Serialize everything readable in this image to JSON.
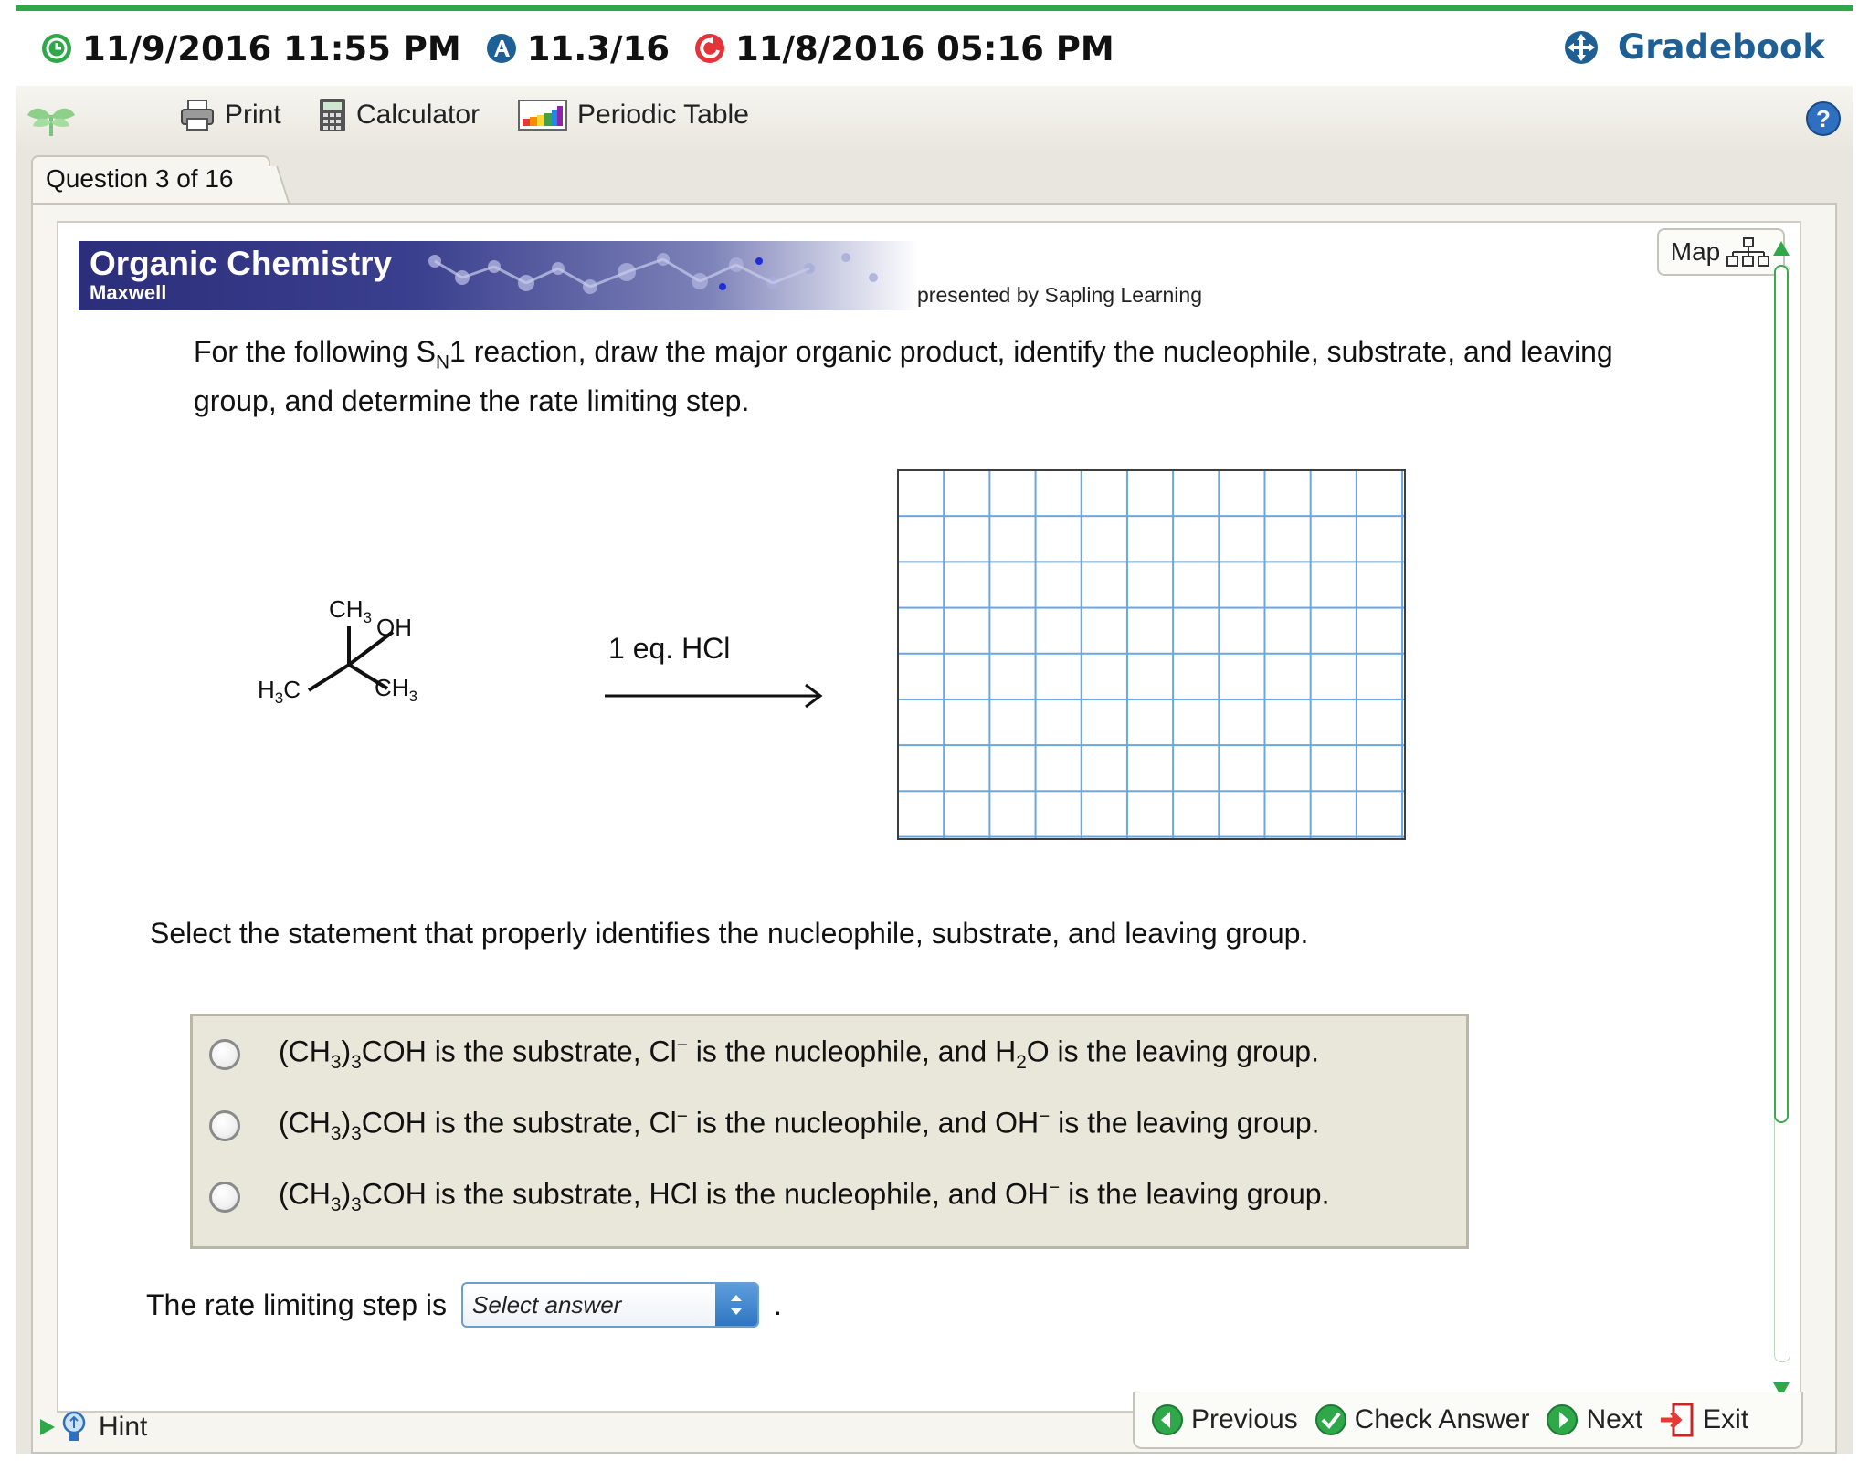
{
  "topbar": {
    "due_date": "11/9/2016 11:55 PM",
    "score": "11.3/16",
    "last_saved": "11/8/2016 05:16 PM",
    "gradebook_label": "Gradebook"
  },
  "toolbar": {
    "print_label": "Print",
    "calculator_label": "Calculator",
    "periodic_table_label": "Periodic Table"
  },
  "question_tab": "Question 3 of 16",
  "banner": {
    "title": "Organic Chemistry",
    "author": "Maxwell",
    "presented_by": "presented by Sapling Learning"
  },
  "map_label": "Map",
  "question": {
    "line_before_sub": "For the following S",
    "sub": "N",
    "line_after_sub": "1 reaction, draw the major organic product, identify the nucleophile, substrate, and leaving group, and determine the rate limiting step."
  },
  "reaction": {
    "reagent": "1 eq. HCl",
    "labels": {
      "top": "CH3",
      "oh": "OH",
      "left": "H3C",
      "right": "CH3"
    }
  },
  "statement": "Select the statement that properly identifies the nucleophile, substrate, and leaving group.",
  "options": [
    {
      "pre": "(CH",
      "s1": "3",
      "mid": ")",
      "s2": "3",
      "post": "COH is the substrate, Cl",
      "sup": "−",
      "tail1": " is the nucleophile, and H",
      "s3": "2",
      "tail2": "O is the leaving group."
    },
    {
      "pre": "(CH",
      "s1": "3",
      "mid": ")",
      "s2": "3",
      "post": "COH is the substrate, Cl",
      "sup": "−",
      "tail1": " is the nucleophile, and OH",
      "sup2": "−",
      "tail2": " is the leaving group."
    },
    {
      "pre": "(CH",
      "s1": "3",
      "mid": ")",
      "s2": "3",
      "post": "COH is the substrate, HCl is the nucleophile, and OH",
      "sup": "−",
      "tail2": " is the leaving group."
    }
  ],
  "rate_step": {
    "label": "The rate limiting step is",
    "select_placeholder": "Select answer",
    "suffix": "."
  },
  "bottom_nav": {
    "previous": "Previous",
    "check_answer": "Check Answer",
    "next": "Next",
    "exit": "Exit",
    "hint": "Hint"
  },
  "colors": {
    "accent_green": "#2fa84a",
    "gradebook_blue": "#1e5f96",
    "banner_navy": "#2b2e7a",
    "grid_blue": "#6aa6e0"
  }
}
